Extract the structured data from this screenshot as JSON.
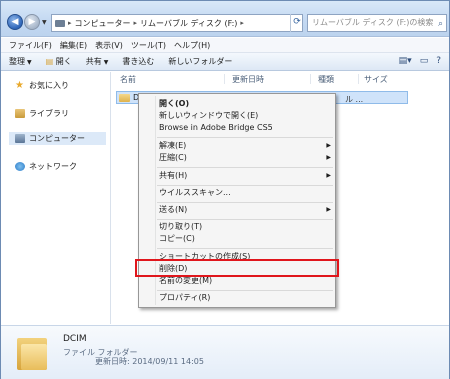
{
  "address": {
    "breadcrumbs": [
      "コンピューター",
      "リムーバブル ディスク (F:)"
    ],
    "search_placeholder": "リムーバブル ディスク (F:)の検索"
  },
  "menubar": [
    "ファイル(F)",
    "編集(E)",
    "表示(V)",
    "ツール(T)",
    "ヘルプ(H)"
  ],
  "commands": {
    "organize": "整理",
    "open": "開く",
    "share": "共有",
    "burn": "書き込む",
    "new_folder": "新しいフォルダー"
  },
  "navpane": {
    "favorites": "お気に入り",
    "libraries": "ライブラリ",
    "computer": "コンピューター",
    "network": "ネットワーク"
  },
  "columns": {
    "name": "名前",
    "date": "更新日時",
    "type": "種類",
    "size": "サイズ"
  },
  "file": {
    "name_partial": "DC",
    "tail": "ル ..."
  },
  "context_menu": {
    "open": "開く(O)",
    "open_new_window": "新しいウィンドウで開く(E)",
    "browse_bridge": "Browse in Adobe Bridge CS5",
    "extract": "解凍(E)",
    "compress": "圧縮(C)",
    "share": "共有(H)",
    "virus_scan": "ウイルススキャン...",
    "send_to": "送る(N)",
    "cut": "切り取り(T)",
    "copy": "コピー(C)",
    "create_shortcut": "ショートカットの作成(S)",
    "delete": "削除(D)",
    "rename": "名前の変更(M)",
    "properties": "プロパティ(R)"
  },
  "details": {
    "name": "DCIM",
    "type": "ファイル フォルダー",
    "modified": "更新日時: 2014/09/11 14:05"
  },
  "colors": {
    "highlight_box": "#e0161c",
    "selection": "#cfe3fa"
  }
}
